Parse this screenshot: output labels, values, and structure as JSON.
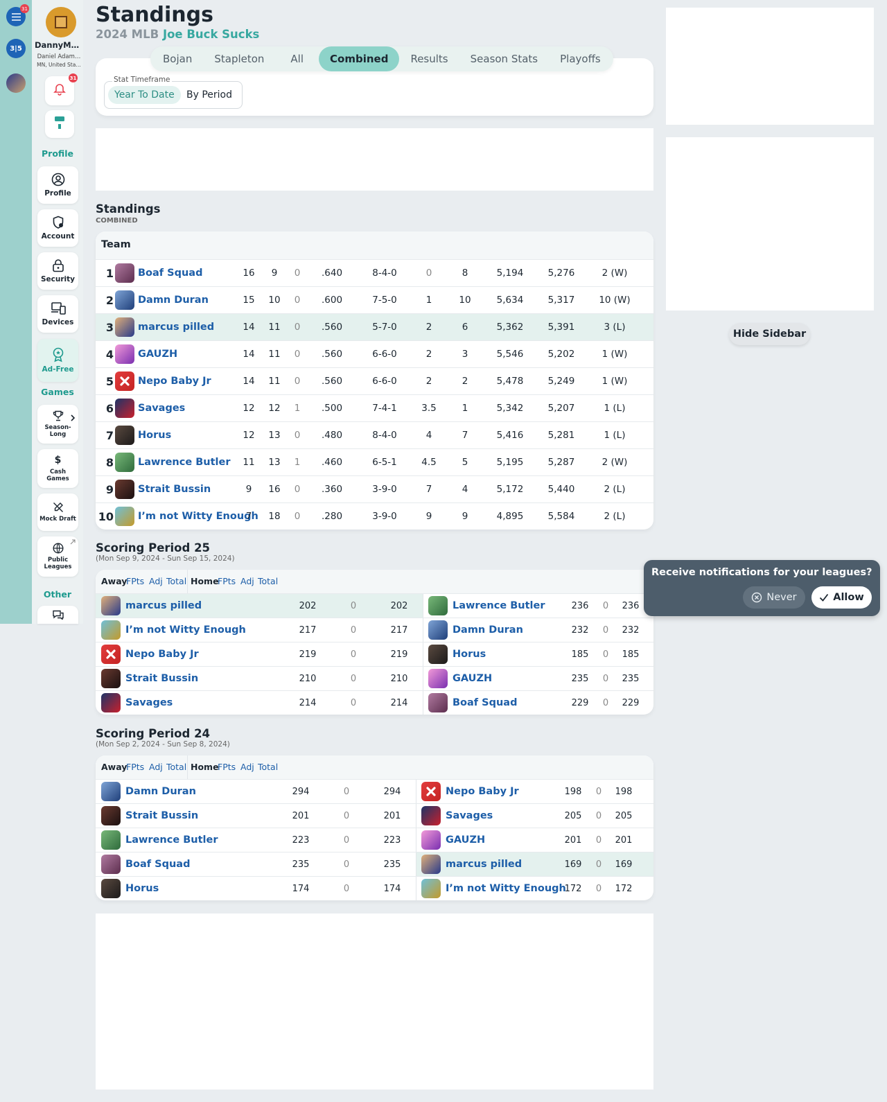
{
  "rail": {
    "menu_badge": "31",
    "app_label": "3|5"
  },
  "nav": {
    "username": "DannyMe…",
    "full_name": "Daniel Adam…",
    "location": "MN, United Sta…",
    "notif_badge": "31",
    "section_profile": "Profile",
    "profile": "Profile",
    "account": "Account",
    "security": "Security",
    "devices": "Devices",
    "ad_free": "Ad-Free",
    "section_games": "Games",
    "season_long": "Season-Long",
    "cash_games": "Cash Games",
    "mock_draft": "Mock Draft",
    "public_leagues": "Public Leagues",
    "section_other": "Other"
  },
  "header": {
    "title": "Standings",
    "season": "2024 MLB",
    "league": "Joe Buck Sucks"
  },
  "tabs": [
    "Bojan",
    "Stapleton",
    "All",
    "Combined",
    "Results",
    "Season Stats",
    "Playoffs"
  ],
  "active_tab": "Combined",
  "timeframe": {
    "legend": "Stat Timeframe",
    "options": [
      "Year To Date",
      "By Period"
    ],
    "selected": "Year To Date"
  },
  "standings": {
    "title": "Standings",
    "subtitle": "COMBINED",
    "team_header": "Team",
    "rows": [
      {
        "rank": "1",
        "team": "Boaf Squad",
        "w": "16",
        "l": "9",
        "t": "0",
        "pct": ".640",
        "rec": "8-4-0",
        "gb": "0",
        "wv": "8",
        "pf": "5,194",
        "pa": "5,276",
        "strk": "2 (W)",
        "avatar": "avatar-purple-person",
        "highlight": false
      },
      {
        "rank": "2",
        "team": "Damn Duran",
        "w": "15",
        "l": "10",
        "t": "0",
        "pct": ".600",
        "rec": "7-5-0",
        "gb": "1",
        "wv": "10",
        "pf": "5,634",
        "pa": "5,317",
        "strk": "10 (W)",
        "avatar": "avatar-helmet-blue",
        "highlight": false
      },
      {
        "rank": "3",
        "team": "marcus pilled",
        "w": "14",
        "l": "11",
        "t": "0",
        "pct": ".560",
        "rec": "5-7-0",
        "gb": "2",
        "wv": "6",
        "pf": "5,362",
        "pa": "5,391",
        "strk": "3 (L)",
        "avatar": "avatar-batter",
        "highlight": true
      },
      {
        "rank": "4",
        "team": "GAUZH",
        "w": "14",
        "l": "11",
        "t": "0",
        "pct": ".560",
        "rec": "6-6-0",
        "gb": "2",
        "wv": "3",
        "pf": "5,546",
        "pa": "5,202",
        "strk": "1 (W)",
        "avatar": "avatar-pink-galaxy",
        "highlight": false
      },
      {
        "rank": "5",
        "team": "Nepo Baby Jr",
        "w": "14",
        "l": "11",
        "t": "0",
        "pct": ".560",
        "rec": "6-6-0",
        "gb": "2",
        "wv": "2",
        "pf": "5,478",
        "pa": "5,249",
        "strk": "1 (W)",
        "avatar": "avatar-red-x",
        "highlight": false
      },
      {
        "rank": "6",
        "team": "Savages",
        "w": "12",
        "l": "12",
        "t": "1",
        "pct": ".500",
        "rec": "7-4-1",
        "gb": "3.5",
        "wv": "1",
        "pf": "5,342",
        "pa": "5,207",
        "strk": "1 (L)",
        "avatar": "avatar-savages",
        "highlight": false
      },
      {
        "rank": "7",
        "team": "Horus",
        "w": "12",
        "l": "13",
        "t": "0",
        "pct": ".480",
        "rec": "8-4-0",
        "gb": "4",
        "wv": "7",
        "pf": "5,416",
        "pa": "5,281",
        "strk": "1 (L)",
        "avatar": "avatar-dark-figure",
        "highlight": false
      },
      {
        "rank": "8",
        "team": "Lawrence Butler",
        "w": "11",
        "l": "13",
        "t": "1",
        "pct": ".460",
        "rec": "6-5-1",
        "gb": "4.5",
        "wv": "5",
        "pf": "5,195",
        "pa": "5,287",
        "strk": "2 (W)",
        "avatar": "avatar-green-bat",
        "highlight": false
      },
      {
        "rank": "9",
        "team": "Strait Bussin",
        "w": "9",
        "l": "16",
        "t": "0",
        "pct": ".360",
        "rec": "3-9-0",
        "gb": "7",
        "wv": "4",
        "pf": "5,172",
        "pa": "5,440",
        "strk": "2 (L)",
        "avatar": "avatar-face",
        "highlight": false
      },
      {
        "rank": "10",
        "team": "I’m not Witty Enough",
        "w": "7",
        "l": "18",
        "t": "0",
        "pct": ".280",
        "rec": "3-9-0",
        "gb": "9",
        "wv": "9",
        "pf": "4,895",
        "pa": "5,584",
        "strk": "2 (L)",
        "avatar": "avatar-cap",
        "highlight": false
      }
    ]
  },
  "periods": [
    {
      "title": "Scoring Period 25",
      "dates": "(Mon Sep 9, 2024 - Sun Sep 15, 2024)",
      "head": {
        "away": "Away",
        "home": "Home",
        "fpts": "FPts",
        "adj": "Adj",
        "total": "Total"
      },
      "matchups": [
        {
          "away": {
            "team": "marcus pilled",
            "fpts": "202",
            "adj": "0",
            "total": "202",
            "avatar": "avatar-batter",
            "hl": true
          },
          "home": {
            "team": "Lawrence Butler",
            "fpts": "236",
            "adj": "0",
            "total": "236",
            "avatar": "avatar-green-bat",
            "hl": false
          }
        },
        {
          "away": {
            "team": "I’m not Witty Enough",
            "fpts": "217",
            "adj": "0",
            "total": "217",
            "avatar": "avatar-cap",
            "hl": false
          },
          "home": {
            "team": "Damn Duran",
            "fpts": "232",
            "adj": "0",
            "total": "232",
            "avatar": "avatar-helmet-blue",
            "hl": false
          }
        },
        {
          "away": {
            "team": "Nepo Baby Jr",
            "fpts": "219",
            "adj": "0",
            "total": "219",
            "avatar": "avatar-red-x",
            "hl": false
          },
          "home": {
            "team": "Horus",
            "fpts": "185",
            "adj": "0",
            "total": "185",
            "avatar": "avatar-dark-figure",
            "hl": false
          }
        },
        {
          "away": {
            "team": "Strait Bussin",
            "fpts": "210",
            "adj": "0",
            "total": "210",
            "avatar": "avatar-face",
            "hl": false
          },
          "home": {
            "team": "GAUZH",
            "fpts": "235",
            "adj": "0",
            "total": "235",
            "avatar": "avatar-pink-galaxy",
            "hl": false
          }
        },
        {
          "away": {
            "team": "Savages",
            "fpts": "214",
            "adj": "0",
            "total": "214",
            "avatar": "avatar-savages",
            "hl": false
          },
          "home": {
            "team": "Boaf Squad",
            "fpts": "229",
            "adj": "0",
            "total": "229",
            "avatar": "avatar-purple-person",
            "hl": false
          }
        }
      ]
    },
    {
      "title": "Scoring Period 24",
      "dates": "(Mon Sep 2, 2024 - Sun Sep 8, 2024)",
      "head": {
        "away": "Away",
        "home": "Home",
        "fpts": "FPts",
        "adj": "Adj",
        "total": "Total"
      },
      "matchups": [
        {
          "away": {
            "team": "Damn Duran",
            "fpts": "294",
            "adj": "0",
            "total": "294",
            "avatar": "avatar-helmet-blue",
            "hl": false
          },
          "home": {
            "team": "Nepo Baby Jr",
            "fpts": "198",
            "adj": "0",
            "total": "198",
            "avatar": "avatar-red-x",
            "hl": false
          }
        },
        {
          "away": {
            "team": "Strait Bussin",
            "fpts": "201",
            "adj": "0",
            "total": "201",
            "avatar": "avatar-face",
            "hl": false
          },
          "home": {
            "team": "Savages",
            "fpts": "205",
            "adj": "0",
            "total": "205",
            "avatar": "avatar-savages",
            "hl": false
          }
        },
        {
          "away": {
            "team": "Lawrence Butler",
            "fpts": "223",
            "adj": "0",
            "total": "223",
            "avatar": "avatar-green-bat",
            "hl": false
          },
          "home": {
            "team": "GAUZH",
            "fpts": "201",
            "adj": "0",
            "total": "201",
            "avatar": "avatar-pink-galaxy",
            "hl": false
          }
        },
        {
          "away": {
            "team": "Boaf Squad",
            "fpts": "235",
            "adj": "0",
            "total": "235",
            "avatar": "avatar-purple-person",
            "hl": false
          },
          "home": {
            "team": "marcus pilled",
            "fpts": "169",
            "adj": "0",
            "total": "169",
            "avatar": "avatar-batter",
            "hl": true
          }
        },
        {
          "away": {
            "team": "Horus",
            "fpts": "174",
            "adj": "0",
            "total": "174",
            "avatar": "avatar-dark-figure",
            "hl": false
          },
          "home": {
            "team": "I’m not Witty Enough",
            "fpts": "172",
            "adj": "0",
            "total": "172",
            "avatar": "avatar-cap",
            "hl": false
          }
        }
      ]
    }
  ],
  "sidebar": {
    "hide_label": "Hide Sidebar"
  },
  "notification": {
    "message": "Receive notifications for your leagues?",
    "never": "Never",
    "allow": "Allow"
  },
  "colors": {
    "accent": "#8dd3c9",
    "link": "#1d5ea8",
    "highlight_row": "#e4f1ee",
    "rail": "#9dd0cc"
  }
}
